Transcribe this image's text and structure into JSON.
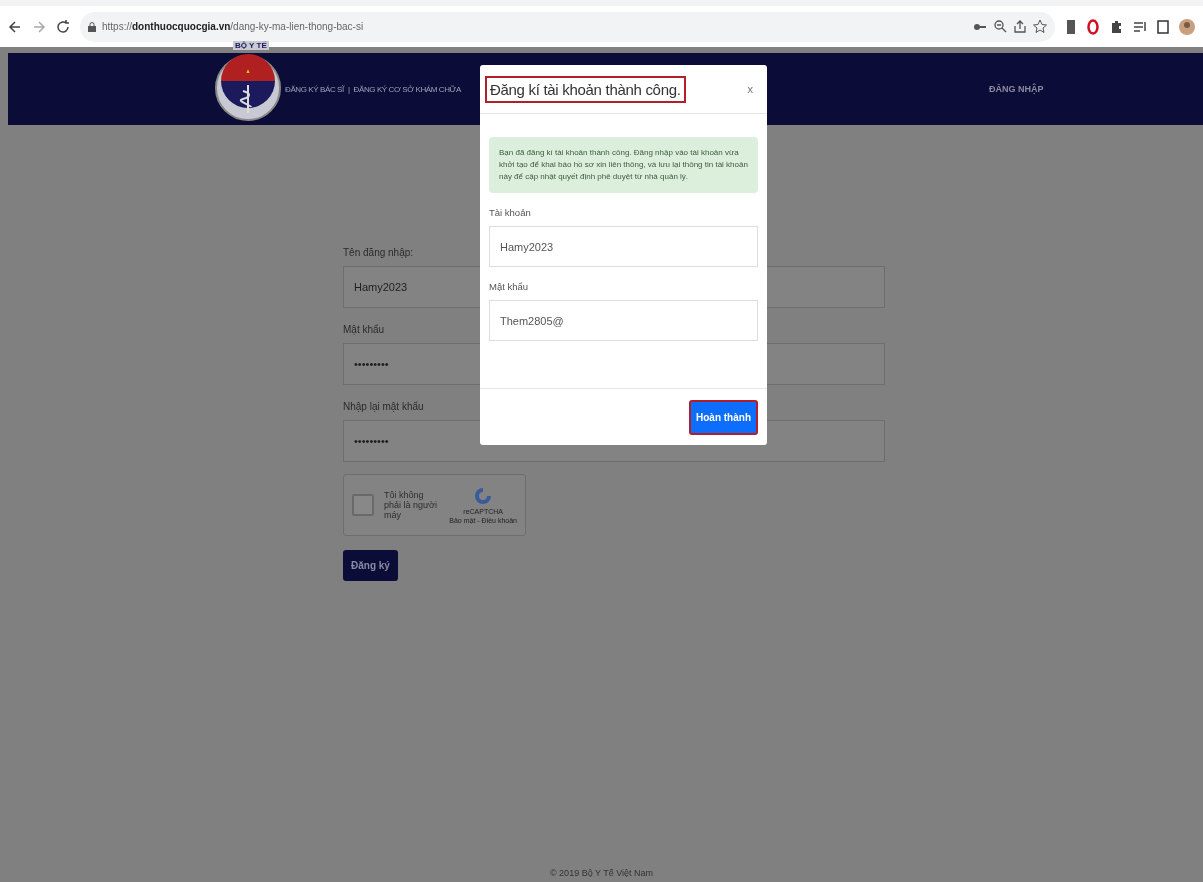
{
  "browser": {
    "url": "https://**donthuocquocgia.vn**/dang-ky-ma-lien-thong-bac-si"
  },
  "header": {
    "logo_text": "BỘ Y TẾ",
    "nav": [
      "ĐĂNG KÝ BÁC SĨ",
      "|",
      "ĐĂNG KÝ CƠ SỞ KHÁM CHỮA"
    ],
    "login": "ĐĂNG NHẬP"
  },
  "form": {
    "fields": [
      {
        "label": "Tên đăng nhập:",
        "value": "Hamy2023"
      },
      {
        "label": "Mật khẩu",
        "value": "•••••••••"
      },
      {
        "label": "Nhập lại mật khẩu",
        "value": "•••••••••"
      }
    ],
    "captcha": {
      "label": "Tôi không phải là người máy",
      "checked": false,
      "brand": "reCAPTCHA",
      "links": "Bảo mật - Điều khoản"
    },
    "submit": "Đăng ký"
  },
  "footer": "© 2019 Bộ Y Tế Việt Nam",
  "modal": {
    "title": "Đăng kí tài khoản thành công.",
    "title_highlighted": true,
    "close": "x",
    "message": "Bạn đã đăng kí tài khoản thành công. Đăng nhập vào tài khoản vừa khởi tạo để khai báo hồ sơ xin liên thông, và lưu lại thông tin tài khoản này để cập nhật quyết định phê duyệt từ nhà quản lý.",
    "fields": [
      {
        "label": "Tài khoản",
        "value": "Hamy2023"
      },
      {
        "label": "Mật khẩu",
        "value": "Them2805@"
      }
    ],
    "button": {
      "label": "Hoàn thành",
      "highlighted": true
    }
  }
}
